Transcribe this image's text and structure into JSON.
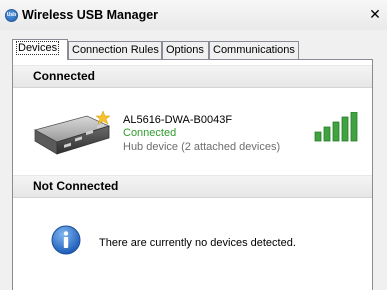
{
  "window": {
    "title": "Wireless USB Manager",
    "app_icon": "usb-app-icon",
    "close_glyph": "✕"
  },
  "tabs": [
    {
      "label": "Devices",
      "active": true
    },
    {
      "label": "Connection Rules",
      "active": false
    },
    {
      "label": "Options",
      "active": false
    },
    {
      "label": "Communications",
      "active": false
    }
  ],
  "connected": {
    "header": "Connected",
    "device": {
      "name": "AL5616-DWA-B0043F",
      "status": "Connected",
      "description": "Hub device (2 attached devices)",
      "icon": "usb-hub-device-icon",
      "signal_bars": 5,
      "signal_color": "#3fa33f"
    }
  },
  "not_connected": {
    "header": "Not Connected",
    "message": "There are currently no devices detected.",
    "icon": "info-icon"
  }
}
